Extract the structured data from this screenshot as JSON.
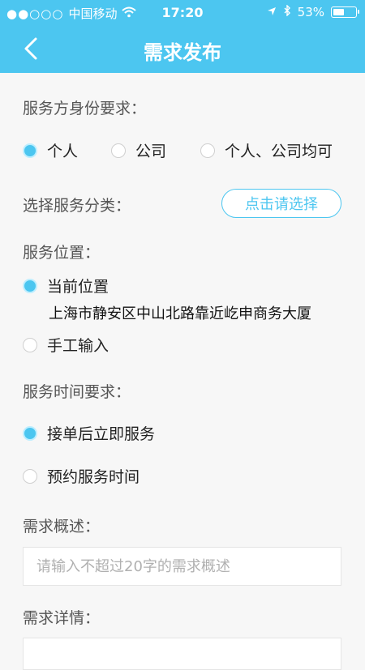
{
  "status_bar": {
    "signal": "●●○○○",
    "carrier": "中国移动",
    "time": "17:20",
    "battery_percent": "53%",
    "battery_level": 0.53
  },
  "nav": {
    "title": "需求发布"
  },
  "identity": {
    "label": "服务方身份要求：",
    "options": [
      "个人",
      "公司",
      "个人、公司均可"
    ],
    "selected": 0
  },
  "category": {
    "label": "选择服务分类：",
    "button": "点击请选择"
  },
  "location": {
    "label": "服务位置：",
    "current_label": "当前位置",
    "address": "上海市静安区中山北路靠近屹申商务大厦",
    "manual_label": "手工输入",
    "selected": "current"
  },
  "time_req": {
    "label": "服务时间要求：",
    "options": [
      "接单后立即服务",
      "预约服务时间"
    ],
    "selected": 0
  },
  "summary": {
    "label": "需求概述：",
    "placeholder": "请输入不超过20字的需求概述",
    "value": ""
  },
  "details": {
    "label": "需求详情："
  },
  "colors": {
    "accent": "#4cc6f0"
  }
}
